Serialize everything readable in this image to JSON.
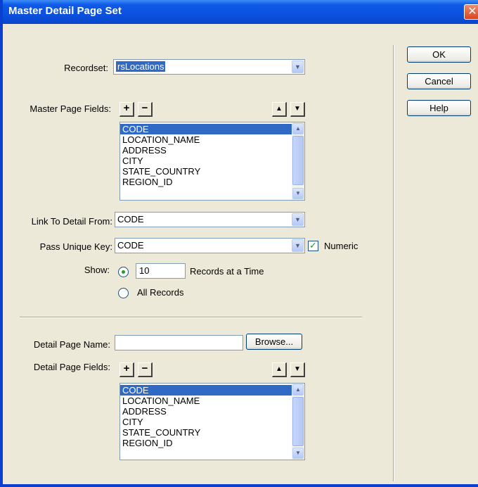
{
  "window": {
    "title": "Master Detail Page Set",
    "close": "✕"
  },
  "recordset": {
    "label": "Recordset:",
    "value": "rsLocations"
  },
  "master": {
    "label": "Master Page Fields:",
    "fields": [
      "CODE",
      "LOCATION_NAME",
      "ADDRESS",
      "CITY",
      "STATE_COUNTRY",
      "REGION_ID"
    ],
    "selected": 0
  },
  "link": {
    "label": "Link To Detail From:",
    "value": "CODE"
  },
  "pass": {
    "label": "Pass Unique Key:",
    "value": "CODE",
    "numeric_label": "Numeric",
    "numeric_checked": true
  },
  "show": {
    "label": "Show:",
    "records_value": "10",
    "records_label": "Records at a Time",
    "all_label": "All Records",
    "selected": "records"
  },
  "detail": {
    "page_name_label": "Detail Page Name:",
    "page_name_value": "",
    "browse_label": "Browse...",
    "fields_label": "Detail Page Fields:",
    "fields": [
      "CODE",
      "LOCATION_NAME",
      "ADDRESS",
      "CITY",
      "STATE_COUNTRY",
      "REGION_ID"
    ],
    "selected": 0
  },
  "buttons": {
    "ok": "OK",
    "cancel": "Cancel",
    "help": "Help"
  },
  "glyphs": {
    "plus": "+",
    "minus": "−",
    "up": "▲",
    "down": "▼",
    "check": "✓"
  }
}
